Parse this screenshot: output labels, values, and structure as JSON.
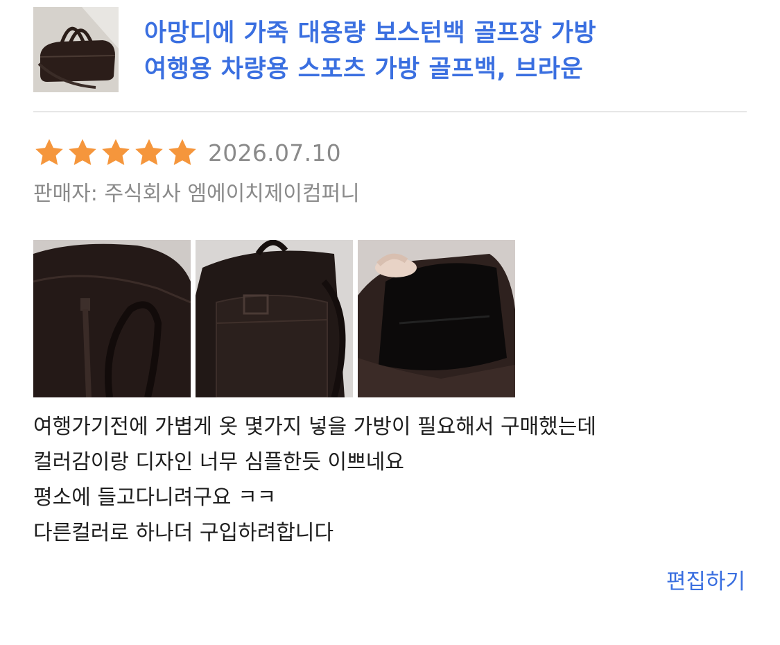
{
  "product": {
    "title_line1": "아망디에 가죽 대용량 보스턴백 골프장 가방",
    "title_line2": "여행용 차량용 스포츠 가방 골프백, 브라운",
    "thumbnail_icon": "duffel-bag-thumbnail"
  },
  "review": {
    "rating": 5,
    "rating_max": 5,
    "date": "2026.07.10",
    "seller": "판매자: 주식회사 엠에이치제이컴퍼니",
    "photos": [
      {
        "icon": "bag-front-photo"
      },
      {
        "icon": "bag-side-photo"
      },
      {
        "icon": "bag-interior-photo"
      }
    ],
    "lines": [
      "여행가기전에 가볍게 옷 몇가지 넣을 가방이 필요해서 구매했는데",
      "컬러감이랑 디자인 너무 심플한듯 이쁘네요",
      "평소에 들고다니려구요 ㅋㅋ",
      "다른컬러로 하나더 구입하려합니다"
    ],
    "edit_label": "편집하기"
  },
  "colors": {
    "accent": "#3a6fe0",
    "star": "#f5963c",
    "muted_text": "#8a8a8a",
    "body_text": "#1e1e1e",
    "divider": "#e6e6e6"
  }
}
